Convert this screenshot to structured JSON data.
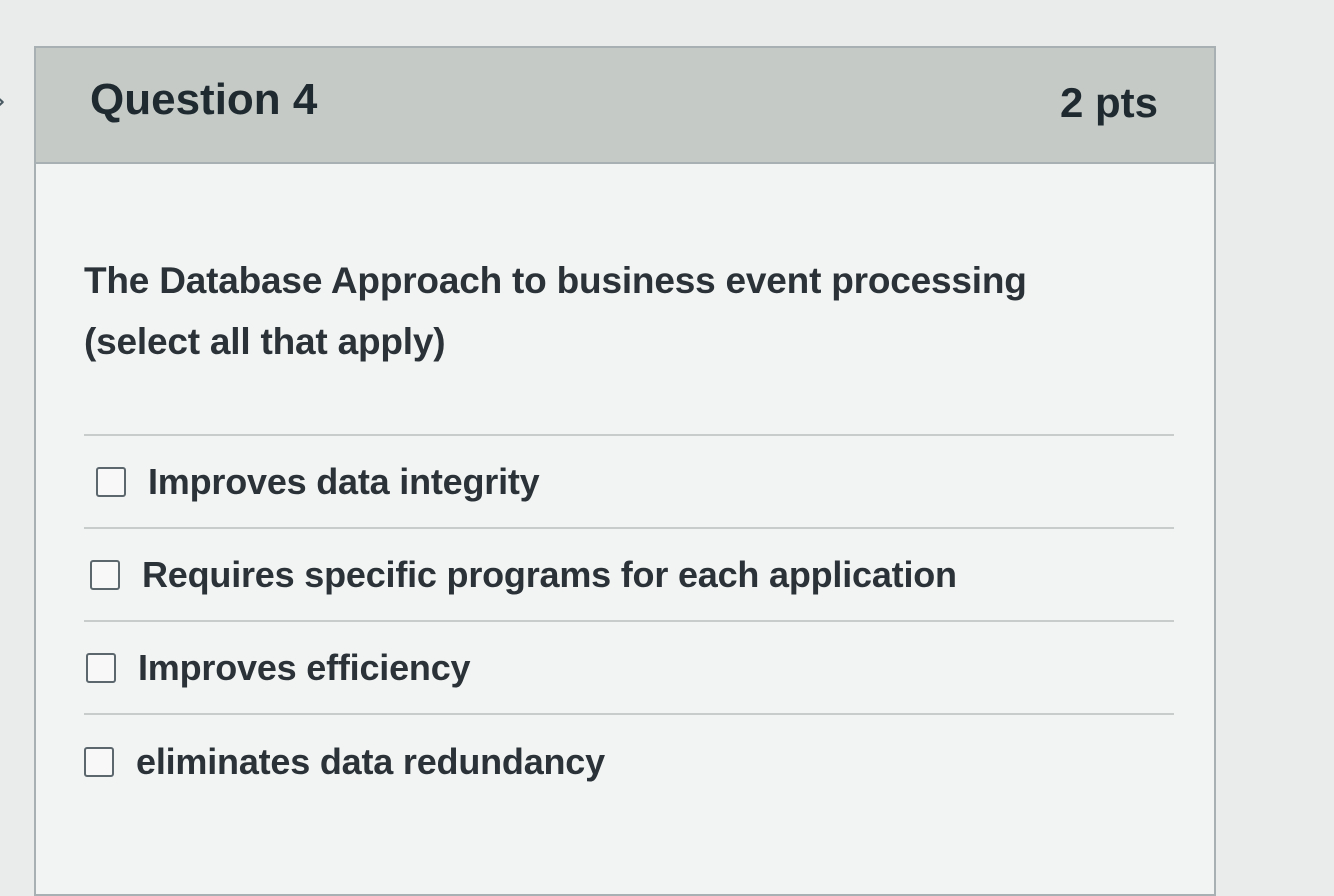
{
  "quiz": {
    "question_title": "Question 4",
    "points": "2 pts",
    "question_text_line1": "The Database Approach to business event processing",
    "question_text_line2": "(select all that apply)",
    "answers": [
      {
        "label": "Improves data integrity",
        "checked": false
      },
      {
        "label": "Requires specific programs for each application",
        "checked": false
      },
      {
        "label": "Improves efficiency",
        "checked": false
      },
      {
        "label": "eliminates data redundancy",
        "checked": false
      }
    ]
  },
  "icons": {
    "nav_chevron": "chevron-right-icon"
  },
  "colors": {
    "header_bg": "#c5cac6",
    "card_bg": "#f2f4f3",
    "text": "#2b3238"
  }
}
